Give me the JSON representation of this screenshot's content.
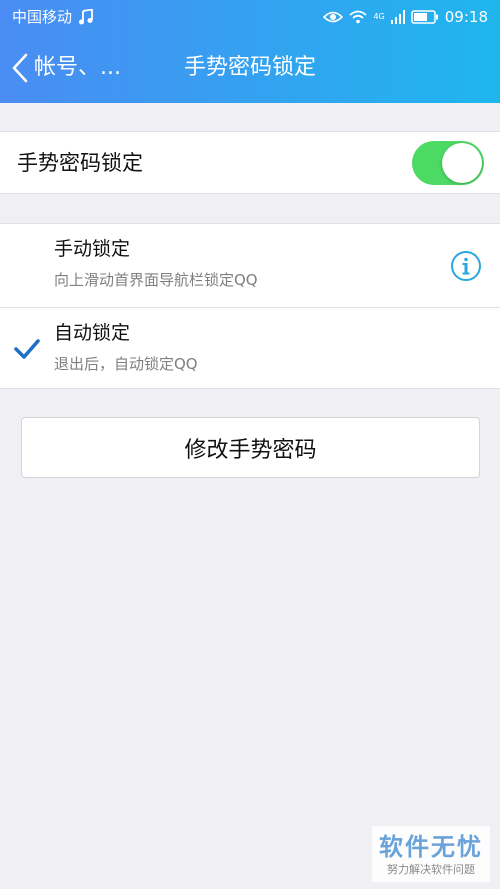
{
  "status_bar": {
    "carrier": "中国移动",
    "network": "4G",
    "time": "09:18"
  },
  "nav": {
    "back_label": "帐号、...",
    "title": "手势密码锁定"
  },
  "toggle_row": {
    "label": "手势密码锁定",
    "enabled": true
  },
  "options": [
    {
      "title": "手动锁定",
      "subtitle": "向上滑动首界面导航栏锁定QQ",
      "selected": false
    },
    {
      "title": "自动锁定",
      "subtitle": "退出后，自动锁定QQ",
      "selected": true
    }
  ],
  "change_button": {
    "label": "修改手势密码"
  },
  "watermark": {
    "line1": "软件无忧",
    "line2": "努力解决软件问题"
  },
  "colors": {
    "header_gradient_start": "#4a8cf3",
    "header_gradient_end": "#1fb6ee",
    "switch_on": "#4cd964",
    "check_blue": "#1f6fc6",
    "info_blue": "#2aa7e0"
  },
  "icons": {
    "music": "music-note-icon",
    "eye": "eye-icon",
    "wifi": "wifi-icon",
    "signal": "signal-icon",
    "battery": "battery-icon",
    "back": "chevron-left-icon",
    "info": "info-icon",
    "check": "checkmark-icon"
  }
}
